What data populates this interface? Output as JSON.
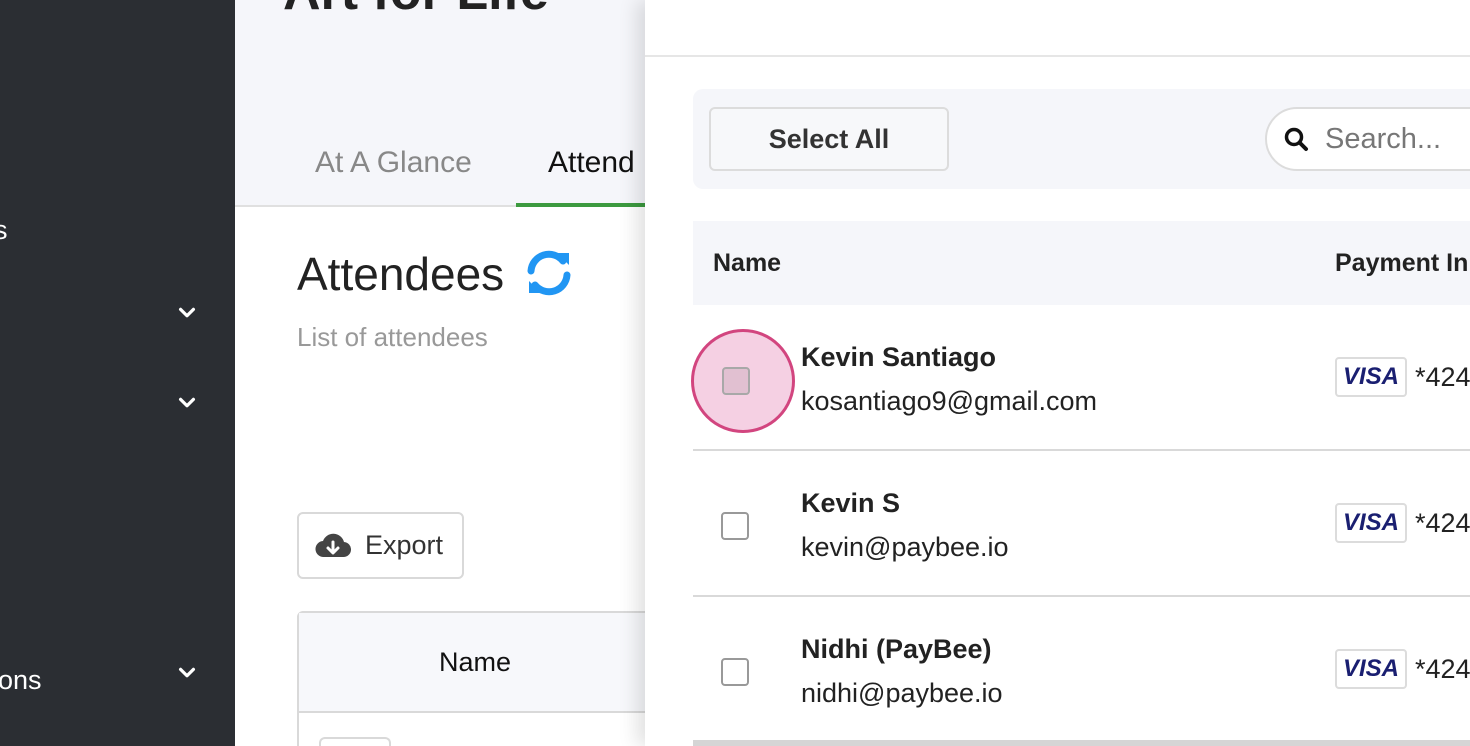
{
  "sidebar": {
    "items": [
      {
        "label": "s",
        "has_chevron": false
      },
      {
        "label": "",
        "has_chevron": true
      },
      {
        "label": "",
        "has_chevron": true
      },
      {
        "label": "ons",
        "has_chevron": true
      }
    ]
  },
  "page": {
    "title": "Art for Life",
    "tabs": [
      {
        "label": "At A Glance",
        "active": false
      },
      {
        "label": "Attend",
        "active": true
      }
    ],
    "section_title": "Attendees",
    "section_subtitle": "List of attendees",
    "export_label": "Export",
    "table_header_name": "Name"
  },
  "drawer": {
    "select_all_label": "Select All",
    "search_placeholder": "Search...",
    "columns": [
      "Name",
      "Payment In"
    ],
    "rows": [
      {
        "name": "Kevin Santiago",
        "email": "kosantiago9@gmail.com",
        "card_brand": "VISA",
        "card_last": "*424",
        "checked": false,
        "focused": true
      },
      {
        "name": "Kevin S",
        "email": "kevin@paybee.io",
        "card_brand": "VISA",
        "card_last": "*424",
        "checked": false,
        "focused": false
      },
      {
        "name": "Nidhi (PayBee)",
        "email": "nidhi@paybee.io",
        "card_brand": "VISA",
        "card_last": "*424",
        "checked": false,
        "focused": false
      }
    ]
  },
  "colors": {
    "sidebar_bg": "#2b2e33",
    "tab_active_underline": "#3c9a3f",
    "refresh_icon": "#2196f3",
    "focus_ring": "#d2457f",
    "visa_blue": "#1a1f71"
  }
}
